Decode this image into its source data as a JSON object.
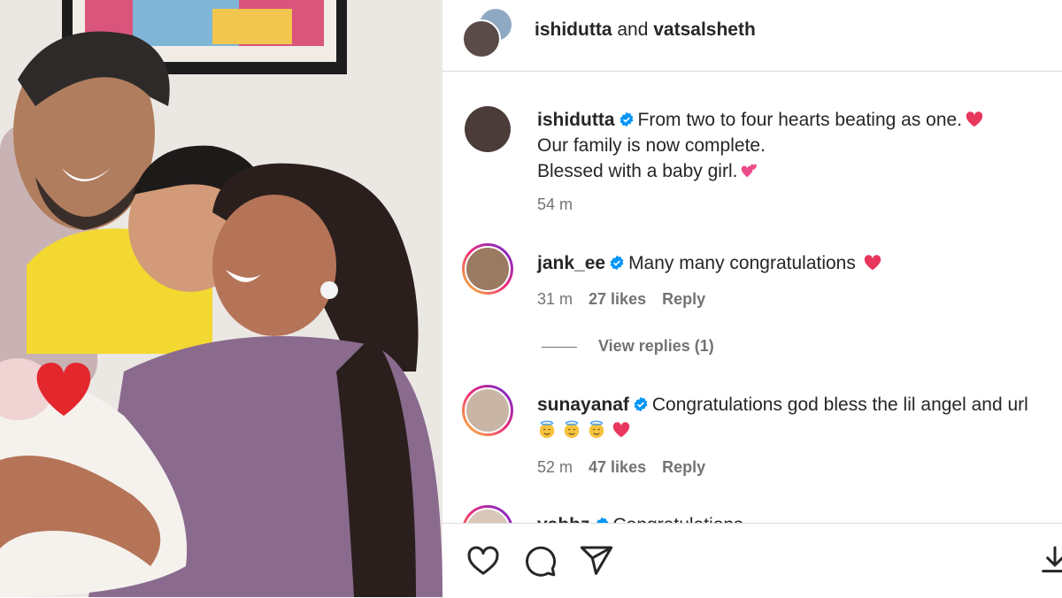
{
  "header": {
    "user1": "ishidutta",
    "and_text": "and",
    "user2": "vatsalsheth"
  },
  "caption": {
    "username": "ishidutta",
    "line1": "From two to four hearts beating as one.",
    "line2": "Our family is now complete.",
    "line3": "Blessed with a baby girl.",
    "time": "54 m"
  },
  "comments": [
    {
      "username": "jank_ee",
      "text": "Many many congratulations",
      "time": "31 m",
      "likes": "27 likes",
      "reply": "Reply"
    },
    {
      "username": "sunayanaf",
      "text": "Congratulations god bless the lil angel and url",
      "time": "52 m",
      "likes": "47 likes",
      "reply": "Reply"
    },
    {
      "username": "vabbz",
      "text": "Congratulations"
    }
  ],
  "view_replies": "View replies (1)",
  "icons": [
    "heart-icon",
    "comment-icon",
    "share-icon",
    "download-icon",
    "verified-icon"
  ],
  "colors": {
    "verified": "#0095f6",
    "heart_emoji": "#e8365d",
    "muted": "#737373"
  }
}
